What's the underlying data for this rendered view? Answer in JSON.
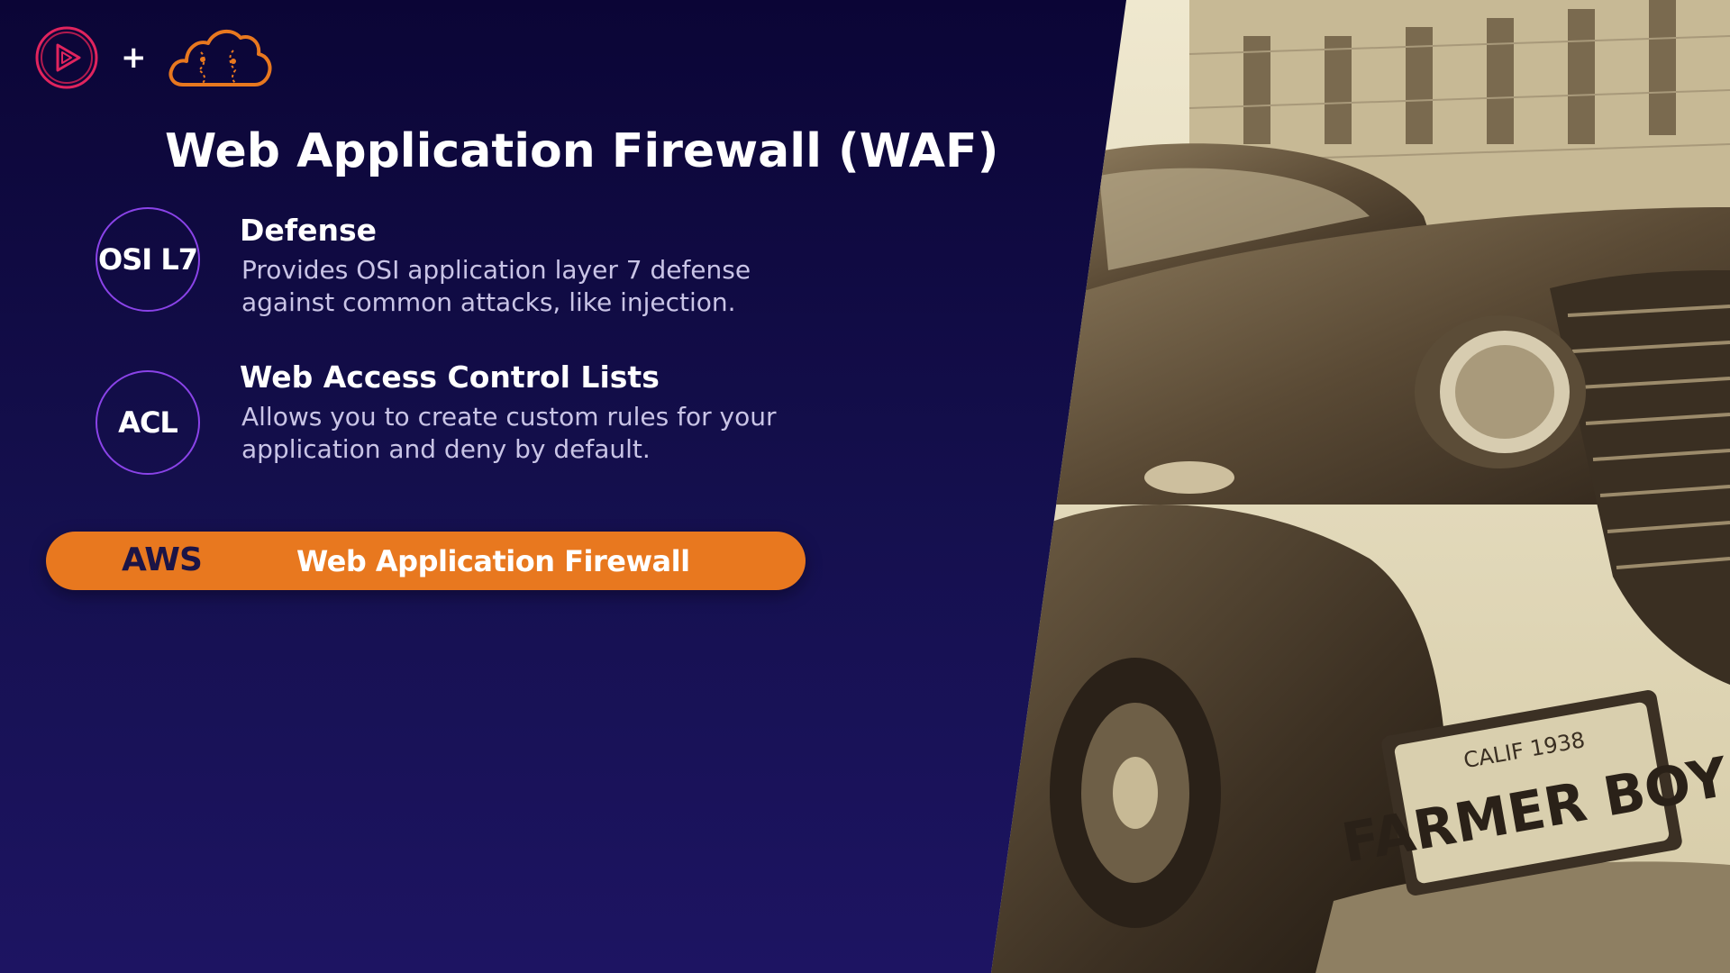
{
  "header": {
    "logo_left": "pluralsight-play-icon",
    "plus": "+",
    "logo_right": "aws-cloud-icon"
  },
  "title": "Web Application Firewall (WAF)",
  "items": [
    {
      "badge": "OSI L7",
      "heading": "Defense",
      "line1": "Provides OSI application layer 7 defense",
      "line2": "against common attacks, like injection."
    },
    {
      "badge": "ACL",
      "heading": "Web Access Control Lists",
      "line1": "Allows you to create custom rules for your",
      "line2": "application and deny by default."
    }
  ],
  "service_pill": {
    "vendor": "AWS",
    "label": "Web Application Firewall"
  },
  "photo": {
    "plate_state": "CALIF 1938",
    "plate_text": "FARMER BOY"
  },
  "colors": {
    "background": "#0b0536",
    "accent_purple": "#8a43e8",
    "accent_orange": "#e8781f",
    "logo_red": "#e0245e"
  }
}
